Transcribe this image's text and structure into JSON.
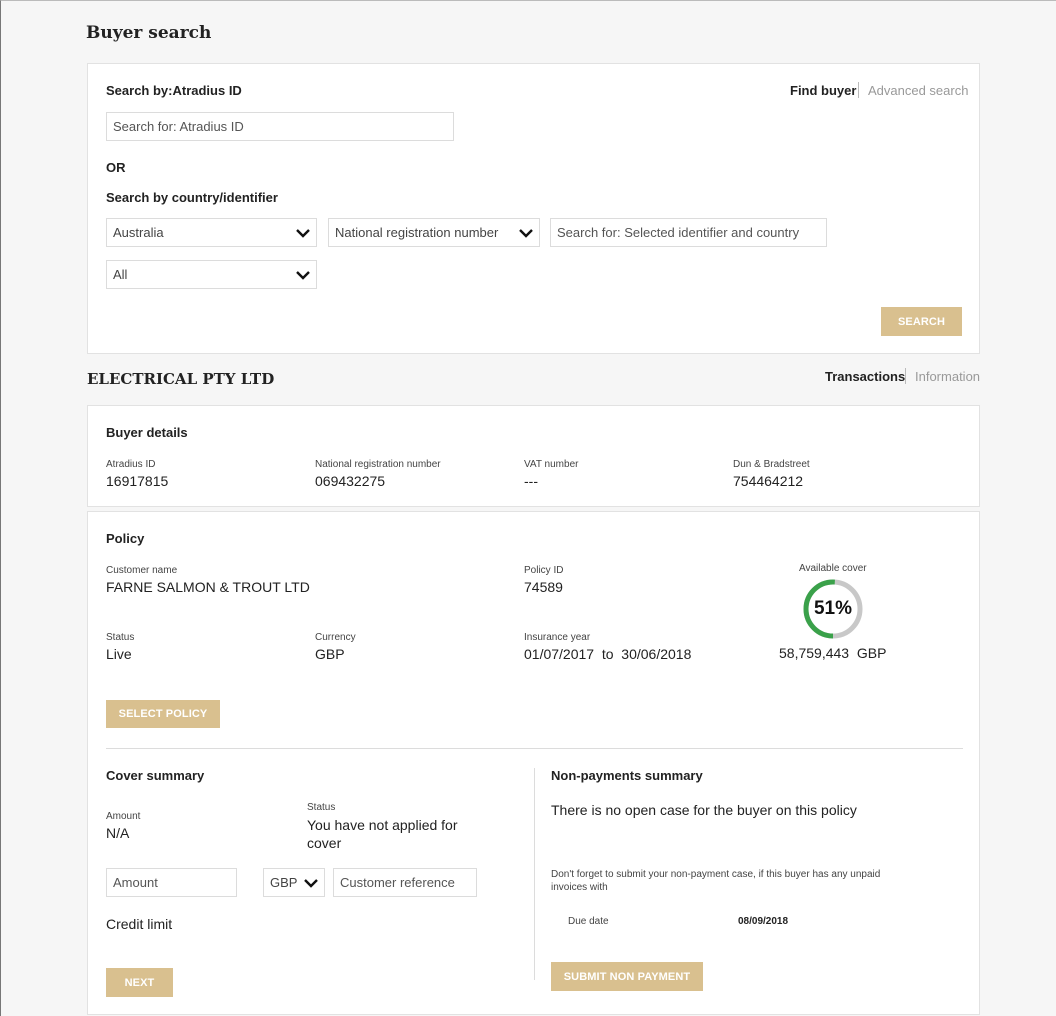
{
  "page_title": "Buyer search",
  "search_card": {
    "search_by_id_label": "Search by:Atradius ID",
    "find_buyer": "Find buyer",
    "advanced_search": "Advanced search",
    "id_placeholder": "Search for: Atradius ID",
    "or_label": "OR",
    "country_label": "Search by country/identifier",
    "country_value": "Australia",
    "identifier_value": "National registration number",
    "identifier_placeholder": "Search for: Selected identifier and country",
    "filter_value": "All",
    "search_button": "SEARCH"
  },
  "buyer": {
    "name": "ELECTRICAL PTY LTD",
    "tab_transactions": "Transactions",
    "tab_information": "Information"
  },
  "buyer_details": {
    "title": "Buyer details",
    "fields": [
      {
        "label": "Atradius ID",
        "value": "16917815"
      },
      {
        "label": "National registration number",
        "value": "069432275"
      },
      {
        "label": "VAT number",
        "value": "---"
      },
      {
        "label": "Dun & Bradstreet",
        "value": "754464212"
      }
    ]
  },
  "policy": {
    "title": "Policy",
    "customer_name_label": "Customer name",
    "customer_name": "FARNE SALMON & TROUT LTD",
    "policy_id_label": "Policy ID",
    "policy_id": "74589",
    "available_cover_label": "Available cover",
    "available_cover_percent": "51%",
    "available_cover_fraction": 0.51,
    "available_cover_amount": "58,759,443  GBP",
    "status_label": "Status",
    "status": "Live",
    "currency_label": "Currency",
    "currency": "GBP",
    "insurance_year_label": "Insurance year",
    "insurance_year": "01/07/2017  to  30/06/2018",
    "select_policy_button": "SELECT POLICY"
  },
  "cover_summary": {
    "title": "Cover summary",
    "amount_label": "Amount",
    "amount": "N/A",
    "status_label": "Status",
    "status": "You have not applied for cover",
    "amount_placeholder": "Amount",
    "currency_select": "GBP",
    "customer_ref_placeholder": "Customer reference",
    "credit_limit": "Credit limit",
    "next_button": "NEXT"
  },
  "non_payments": {
    "title": "Non-payments summary",
    "message": "There is no open case for the buyer on this policy",
    "reminder": "Don't forget to submit your non-payment case, if this buyer has any unpaid invoices with",
    "due_date_label": "Due date",
    "due_date": "08/09/2018",
    "submit_button": "SUBMIT NON PAYMENT"
  },
  "colors": {
    "accent_gold": "#d9c08f",
    "gauge_green": "#3aa14a",
    "gauge_grey": "#c8c8c8"
  }
}
